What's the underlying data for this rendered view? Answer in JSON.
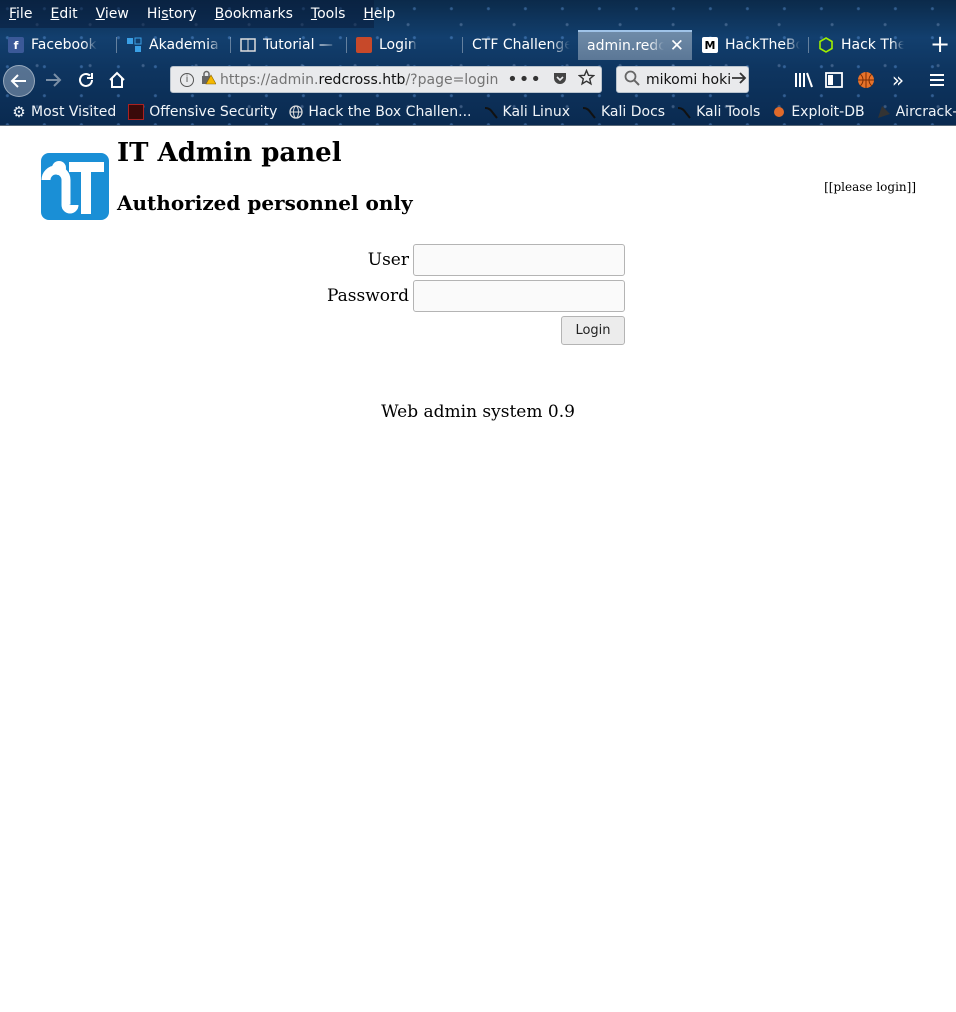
{
  "menubar": [
    "File",
    "Edit",
    "View",
    "History",
    "Bookmarks",
    "Tools",
    "Help"
  ],
  "menubar_access_keys": [
    "F",
    "E",
    "V",
    "s",
    "B",
    "T",
    "H"
  ],
  "tabs": [
    {
      "title": "Facebook",
      "icon": "facebook-icon"
    },
    {
      "title": "Akademia E",
      "icon": "akademia-icon"
    },
    {
      "title": "Tutorial — P",
      "icon": "tutorial-icon"
    },
    {
      "title": "Login",
      "icon": "login-icon"
    },
    {
      "title": "CTF Challenges",
      "icon": ""
    },
    {
      "title": "admin.redcr",
      "icon": "",
      "active": true
    },
    {
      "title": "HackTheBox",
      "icon": "medium-icon"
    },
    {
      "title": "Hack The Bo",
      "icon": "htb-icon"
    }
  ],
  "urlbar": {
    "prefix": "https://admin.",
    "host": "redcross.htb",
    "path": "/?page=login"
  },
  "search": {
    "value": "mikomi hoki"
  },
  "bookmarks": [
    "Most Visited",
    "Offensive Security",
    "Hack the Box Challen...",
    "Kali Linux",
    "Kali Docs",
    "Kali Tools",
    "Exploit-DB",
    "Aircrack-ng"
  ],
  "page": {
    "title": "IT Admin panel",
    "subtitle": "Authorized personnel only",
    "login_link": "[[please login]]",
    "user_label": "User",
    "password_label": "Password",
    "login_button": "Login",
    "footer": "Web admin system 0.9",
    "logo_text": "iT"
  }
}
